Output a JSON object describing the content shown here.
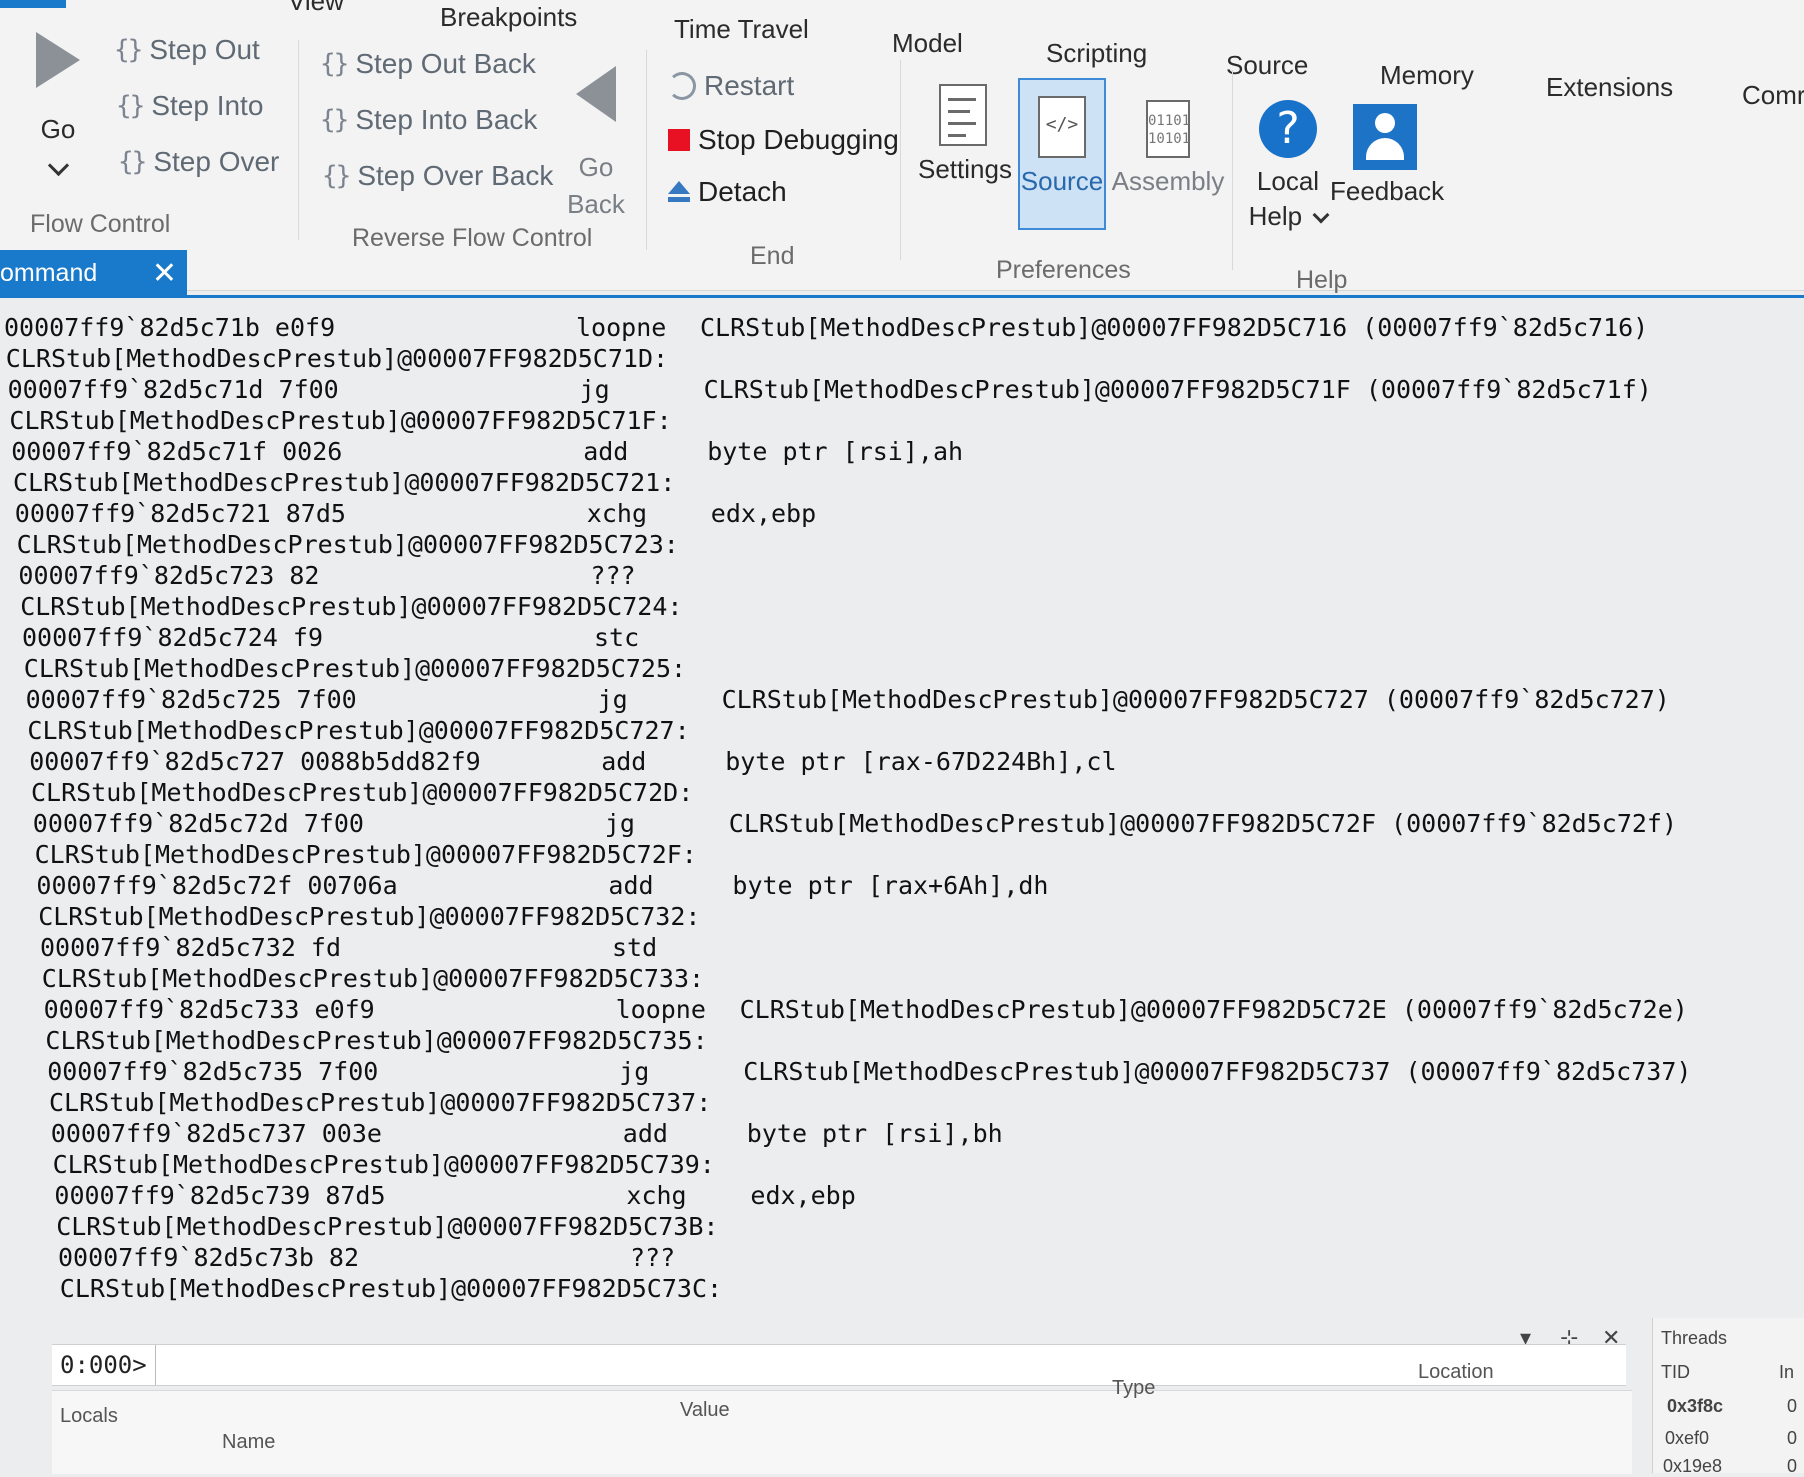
{
  "menu_tabs": [
    "View",
    "Breakpoints",
    "Time Travel",
    "Model",
    "Scripting",
    "Source",
    "Memory",
    "Extensions",
    "Comr"
  ],
  "flow_control": {
    "go_label": "Go",
    "step_out": "Step Out",
    "step_into": "Step Into",
    "step_over": "Step Over",
    "group_label": "Flow Control"
  },
  "reverse_flow_control": {
    "step_out_back": "Step Out Back",
    "step_into_back": "Step Into Back",
    "step_over_back": "Step Over Back",
    "go_back_line1": "Go",
    "go_back_line2": "Back",
    "group_label": "Reverse Flow Control"
  },
  "end": {
    "restart": "Restart",
    "stop_debugging": "Stop Debugging",
    "detach": "Detach",
    "group_label": "End"
  },
  "preferences": {
    "settings": "Settings",
    "source": "Source",
    "assembly": "Assembly",
    "group_label": "Preferences"
  },
  "help": {
    "local_help_line1": "Local",
    "local_help_line2": "Help",
    "feedback": "Feedback",
    "group_label": "Help"
  },
  "command_tab": {
    "label": "ommand",
    "close": "✕"
  },
  "disassembly": [
    {
      "addr": "00007ff9`82d5c71b e0f9",
      "mn": "loopne",
      "op": "CLRStub[MethodDescPrestub]@00007FF982D5C716 (00007ff9`82d5c716)"
    },
    {
      "addr": "CLRStub[MethodDescPrestub]@00007FF982D5C71D:",
      "mn": "",
      "op": ""
    },
    {
      "addr": "00007ff9`82d5c71d 7f00",
      "mn": "jg",
      "op": "CLRStub[MethodDescPrestub]@00007FF982D5C71F (00007ff9`82d5c71f)"
    },
    {
      "addr": "CLRStub[MethodDescPrestub]@00007FF982D5C71F:",
      "mn": "",
      "op": ""
    },
    {
      "addr": "00007ff9`82d5c71f 0026",
      "mn": "add",
      "op": "byte ptr [rsi],ah"
    },
    {
      "addr": "CLRStub[MethodDescPrestub]@00007FF982D5C721:",
      "mn": "",
      "op": ""
    },
    {
      "addr": "00007ff9`82d5c721 87d5",
      "mn": "xchg",
      "op": "edx,ebp"
    },
    {
      "addr": "CLRStub[MethodDescPrestub]@00007FF982D5C723:",
      "mn": "",
      "op": ""
    },
    {
      "addr": "00007ff9`82d5c723 82",
      "mn": "???",
      "op": ""
    },
    {
      "addr": "CLRStub[MethodDescPrestub]@00007FF982D5C724:",
      "mn": "",
      "op": ""
    },
    {
      "addr": "00007ff9`82d5c724 f9",
      "mn": "stc",
      "op": ""
    },
    {
      "addr": "CLRStub[MethodDescPrestub]@00007FF982D5C725:",
      "mn": "",
      "op": ""
    },
    {
      "addr": "00007ff9`82d5c725 7f00",
      "mn": "jg",
      "op": "CLRStub[MethodDescPrestub]@00007FF982D5C727 (00007ff9`82d5c727)"
    },
    {
      "addr": "CLRStub[MethodDescPrestub]@00007FF982D5C727:",
      "mn": "",
      "op": ""
    },
    {
      "addr": "00007ff9`82d5c727 0088b5dd82f9",
      "mn": "add",
      "op": "byte ptr [rax-67D224Bh],cl"
    },
    {
      "addr": "CLRStub[MethodDescPrestub]@00007FF982D5C72D:",
      "mn": "",
      "op": ""
    },
    {
      "addr": "00007ff9`82d5c72d 7f00",
      "mn": "jg",
      "op": "CLRStub[MethodDescPrestub]@00007FF982D5C72F (00007ff9`82d5c72f)"
    },
    {
      "addr": "CLRStub[MethodDescPrestub]@00007FF982D5C72F:",
      "mn": "",
      "op": ""
    },
    {
      "addr": "00007ff9`82d5c72f 00706a",
      "mn": "add",
      "op": "byte ptr [rax+6Ah],dh"
    },
    {
      "addr": "CLRStub[MethodDescPrestub]@00007FF982D5C732:",
      "mn": "",
      "op": ""
    },
    {
      "addr": "00007ff9`82d5c732 fd",
      "mn": "std",
      "op": ""
    },
    {
      "addr": "CLRStub[MethodDescPrestub]@00007FF982D5C733:",
      "mn": "",
      "op": ""
    },
    {
      "addr": "00007ff9`82d5c733 e0f9",
      "mn": "loopne",
      "op": "CLRStub[MethodDescPrestub]@00007FF982D5C72E (00007ff9`82d5c72e)"
    },
    {
      "addr": "CLRStub[MethodDescPrestub]@00007FF982D5C735:",
      "mn": "",
      "op": ""
    },
    {
      "addr": "00007ff9`82d5c735 7f00",
      "mn": "jg",
      "op": "CLRStub[MethodDescPrestub]@00007FF982D5C737 (00007ff9`82d5c737)"
    },
    {
      "addr": "CLRStub[MethodDescPrestub]@00007FF982D5C737:",
      "mn": "",
      "op": ""
    },
    {
      "addr": "00007ff9`82d5c737 003e",
      "mn": "add",
      "op": "byte ptr [rsi],bh"
    },
    {
      "addr": "CLRStub[MethodDescPrestub]@00007FF982D5C739:",
      "mn": "",
      "op": ""
    },
    {
      "addr": "00007ff9`82d5c739 87d5",
      "mn": "xchg",
      "op": "edx,ebp"
    },
    {
      "addr": "CLRStub[MethodDescPrestub]@00007FF982D5C73B:",
      "mn": "",
      "op": ""
    },
    {
      "addr": "00007ff9`82d5c73b 82",
      "mn": "???",
      "op": ""
    },
    {
      "addr": "CLRStub[MethodDescPrestub]@00007FF982D5C73C:",
      "mn": "",
      "op": ""
    }
  ],
  "command_input": {
    "prompt": "0:000>",
    "value": "",
    "dropdown": "▾",
    "pin": "⊹",
    "close": "✕"
  },
  "locals": {
    "title": "Locals",
    "col_name": "Name",
    "col_value": "Value",
    "col_type": "Type",
    "col_location": "Location"
  },
  "threads": {
    "title": "Threads",
    "col_tid": "TID",
    "col_in": "In",
    "tids": [
      "0x3f8c",
      "0xef0",
      "0x19e8"
    ],
    "in_values": [
      "0",
      "0",
      "0"
    ]
  },
  "colors": {
    "accent": "#1979ca",
    "stop_red": "#e81123",
    "selection_fill": "#cde2f5"
  }
}
